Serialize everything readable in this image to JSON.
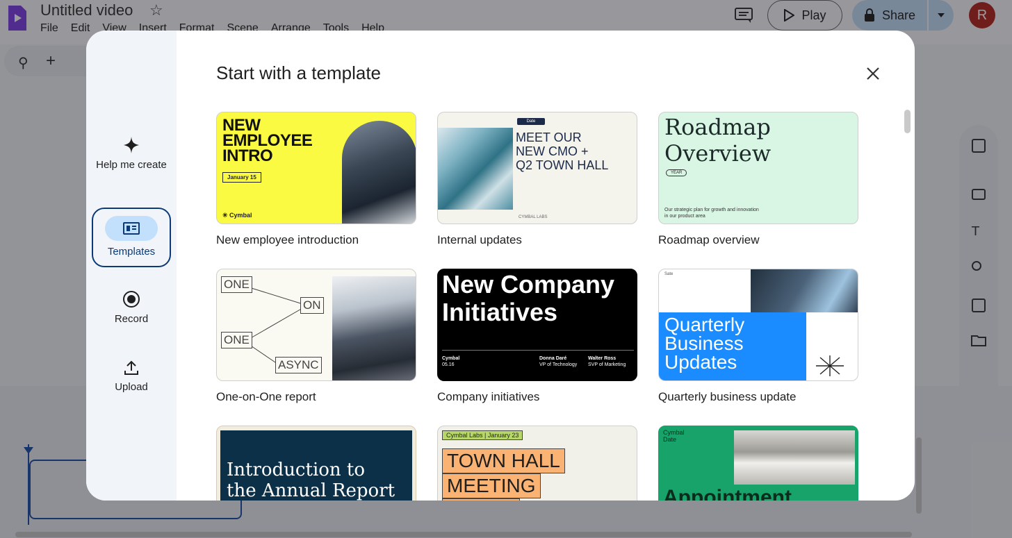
{
  "app": {
    "doc_title": "Untitled video",
    "menu": [
      "File",
      "Edit",
      "View",
      "Insert",
      "Format",
      "Scene",
      "Arrange",
      "Tools",
      "Help"
    ],
    "play_label": "Play",
    "share_label": "Share",
    "avatar_initial": "R"
  },
  "modal": {
    "heading": "Start with a template",
    "side": {
      "help_label": "Help me create",
      "templates_label": "Templates",
      "record_label": "Record",
      "upload_label": "Upload"
    },
    "templates": [
      {
        "caption": "New employee introduction",
        "title_l1": "NEW",
        "title_l2": "EMPLOYEE",
        "title_l3": "INTRO",
        "date": "January 15",
        "brand": "✳ Cymbal"
      },
      {
        "caption": "Internal updates",
        "date_tag": "Date",
        "title_l1": "MEET OUR",
        "title_l2": "NEW CMO +",
        "title_l3": "Q2 TOWN HALL",
        "footer": "CYMBAL LABS"
      },
      {
        "caption": "Roadmap overview",
        "title_l1": "Roadmap",
        "title_l2": "Overview",
        "year": "YEAR",
        "desc": "Our strategic plan for growth and innovation in our product area"
      },
      {
        "caption": "One-on-One report",
        "box1": "ONE",
        "box2": "ON",
        "box3": "ONE",
        "box4": "ASYNC"
      },
      {
        "caption": "Company initiatives",
        "title_l1": "New Company",
        "title_l2": "Initiatives",
        "brand": "Cymbal",
        "date": "05.16",
        "p1_name": "Donna Daré",
        "p1_role": "VP of Technology",
        "p2_name": "Walter Ross",
        "p2_role": "SVP of Marketing"
      },
      {
        "caption": "Quarterly business update",
        "small": "Sate",
        "title_l1": "Quarterly",
        "title_l2": "Business",
        "title_l3": "Updates"
      },
      {
        "title_l1": "Introduction to",
        "title_l2": "the Annual Report"
      },
      {
        "tag": "Cymbal Labs  |  January 23",
        "title_l1": "TOWN HALL",
        "title_l2": "MEETING"
      },
      {
        "tag_l1": "Cymbal",
        "tag_l2": "Date",
        "title": "Appointment"
      }
    ]
  }
}
